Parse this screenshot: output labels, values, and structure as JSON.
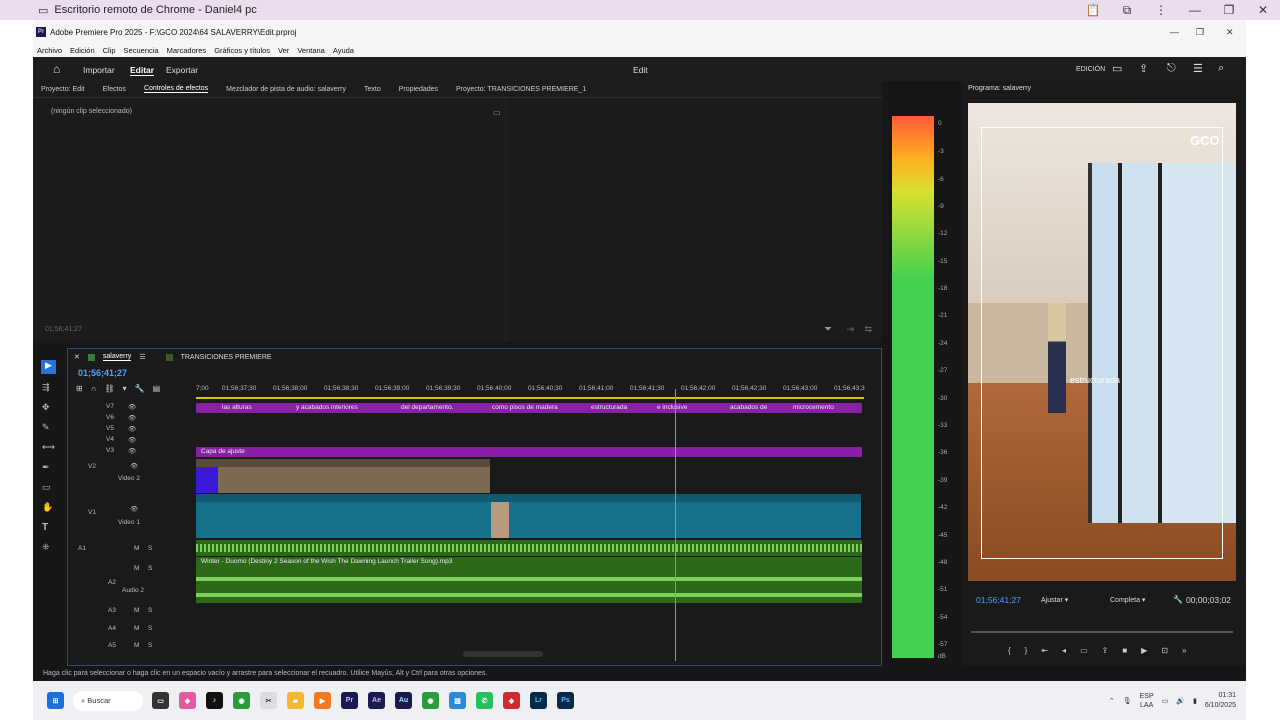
{
  "chrome": {
    "title": "Escritorio remoto de Chrome - Daniel4 pc"
  },
  "premiere": {
    "title": "Adobe Premiere Pro 2025 - F:\\GCO 2024\\64 SALAVERRY\\Edit.prproj",
    "menu": [
      "Archivo",
      "Edición",
      "Clip",
      "Secuencia",
      "Marcadores",
      "Gráficos y títulos",
      "Ver",
      "Ventana",
      "Ayuda"
    ],
    "workspaces": {
      "import": "Importar",
      "edit": "Editar",
      "export": "Exportar",
      "center": "Edit",
      "mode": "EDICIÓN"
    },
    "panel_tabs": [
      "Proyecto: Edit",
      "Efectos",
      "Controles de efectos",
      "Mezclador de pista de audio: salaverry",
      "Texto",
      "Propiedades",
      "Proyecto: TRANSICIONES PREMIERE_1"
    ],
    "effect_controls": {
      "no_clip": "(ningún clip seleccionado)",
      "timecode": "01;56;41;27"
    },
    "timeline": {
      "tabs": [
        "salaverry",
        "TRANSICIONES PREMIERE"
      ],
      "timecode": "01;56;41;27",
      "ruler": [
        "7;00",
        "01;56;37;30",
        "01;56;38;00",
        "01;56;38;30",
        "01;56;39;00",
        "01;56;39;30",
        "01;56;40;00",
        "01;56;40;30",
        "01;56;41;00",
        "01;56;41;30",
        "01;56;42;00",
        "01;56;42;30",
        "01;56;43;00",
        "01;56;43;3"
      ],
      "video_tracks": [
        "V7",
        "V6",
        "V5",
        "V4",
        "V3",
        "V2",
        "V1"
      ],
      "video2_label": "Video 2",
      "video1_label": "Video 1",
      "audio_tracks": [
        "A1",
        "A2",
        "A3",
        "A4",
        "A5"
      ],
      "audio2_label": "Audio 2",
      "v7_captions": [
        "las alturas",
        "y acabados interiores",
        "del departamento.",
        "como pisos de madera",
        "estructurada",
        "e inclusive",
        "acabados de",
        "microcemento"
      ],
      "v3_clip": "Capa de ajuste",
      "v2_clip": "IMG_3925.MOV",
      "v1_clips": [
        "IMG_3961.MOV",
        "IMG_3886.MOV"
      ],
      "a2_clip": "Winter - Duomo (Destiny 2 Season of the Wish The Dawning Launch Trailer Song).mp3"
    },
    "meter": {
      "labels": [
        "0",
        "-3",
        "-6",
        "-9",
        "-12",
        "-15",
        "-18",
        "-21",
        "-24",
        "-27",
        "-30",
        "-33",
        "-36",
        "-39",
        "-42",
        "-45",
        "-48",
        "-51",
        "-54",
        "-57",
        "dB"
      ]
    },
    "program": {
      "title": "Programa: salaverry",
      "timecode": "01;56;41;27",
      "fit": "Ajustar",
      "quality": "Completa",
      "duration": "00;00;03;02",
      "caption": "estructurada",
      "logo": "GCO"
    },
    "status": "Haga clic para seleccionar o haga clic en un espacio vacío y arrastre para seleccionar el recuadro. Utilice Mayús, Alt y Ctrl para otras opciones."
  },
  "taskbar": {
    "search": "Buscar",
    "lang": "ESP",
    "lang2": "LAA",
    "time": "01:31",
    "date": "6/10/2025"
  }
}
